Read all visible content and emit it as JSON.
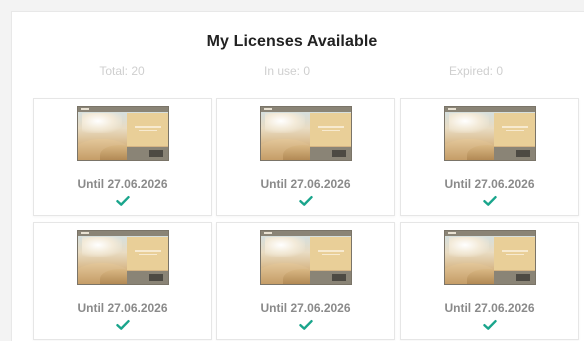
{
  "page": {
    "title": "My Licenses Available"
  },
  "stats": {
    "total": "Total: 20",
    "in_use": "In use: 0",
    "expired": "Expired: 0"
  },
  "licenses": [
    {
      "until": "Until 27.06.2026",
      "status_icon": "check-icon"
    },
    {
      "until": "Until 27.06.2026",
      "status_icon": "check-icon"
    },
    {
      "until": "Until 27.06.2026",
      "status_icon": "check-icon"
    },
    {
      "until": "Until 27.06.2026",
      "status_icon": "check-icon"
    },
    {
      "until": "Until 27.06.2026",
      "status_icon": "check-icon"
    },
    {
      "until": "Until 27.06.2026",
      "status_icon": "check-icon"
    }
  ],
  "colors": {
    "check": "#1aa58c",
    "title": "#222222",
    "muted": "#cfcfcf",
    "until": "#8a8a8a"
  }
}
